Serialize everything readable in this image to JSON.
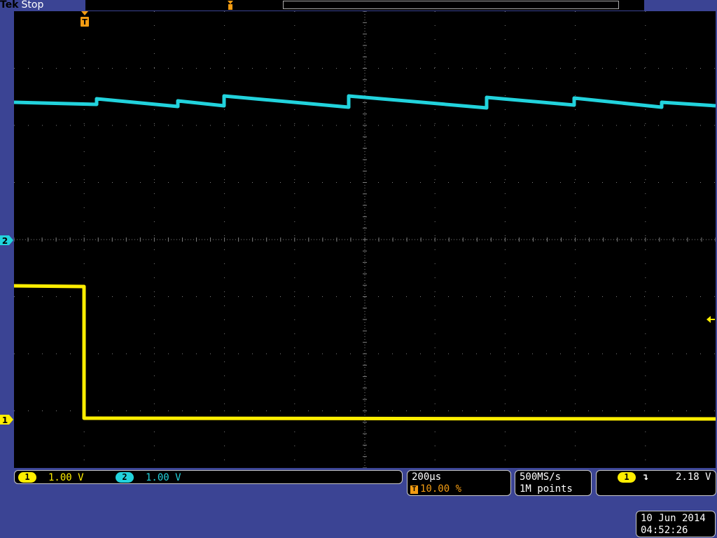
{
  "header": {
    "brand": "Tek",
    "run_state": "Stop"
  },
  "colors": {
    "ch1": "#ffee00",
    "ch2": "#22d3dd",
    "trigger": "#f39c12",
    "grid": "#7f7f7f",
    "frame": "#3b4494"
  },
  "markers": {
    "trigger_position": "T",
    "ch2": "2",
    "ch1": "1"
  },
  "channels": [
    {
      "id": "1",
      "scale": "1.00 V"
    },
    {
      "id": "2",
      "scale": "1.00 V"
    }
  ],
  "horizontal": {
    "scale": "200µs",
    "trigger_badge": "T",
    "position": "10.00 %"
  },
  "acquisition": {
    "sample_rate": "500MS/s",
    "record_length": "1M points"
  },
  "trigger": {
    "source": "1",
    "slope_icon": "falling-edge-icon",
    "slope_glyph": "↴",
    "level": "2.18 V"
  },
  "datetime": {
    "date": "10 Jun 2014",
    "time": "04:52:26"
  }
}
